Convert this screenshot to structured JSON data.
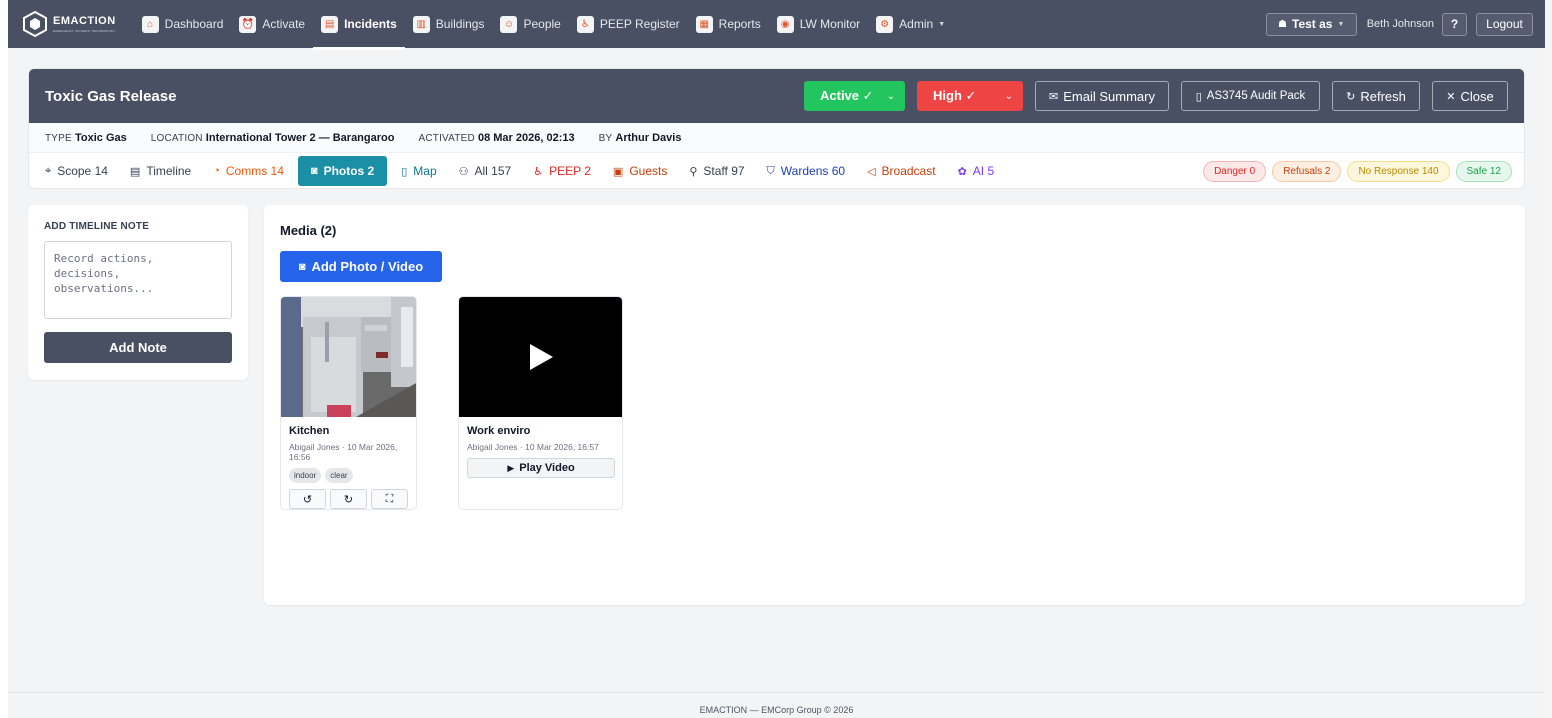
{
  "brand": {
    "name": "EMACTION",
    "tagline": "EMERGENCY INCIDENT INFORMATION"
  },
  "nav": {
    "items": [
      {
        "label": "Dashboard",
        "icon": "home-icon",
        "glyph": "⌂",
        "active": false
      },
      {
        "label": "Activate",
        "icon": "alarm-icon",
        "glyph": "⏰",
        "active": false
      },
      {
        "label": "Incidents",
        "icon": "clipboard-icon",
        "glyph": "▤",
        "active": true
      },
      {
        "label": "Buildings",
        "icon": "building-icon",
        "glyph": "▥",
        "active": false
      },
      {
        "label": "People",
        "icon": "person-icon",
        "glyph": "☺",
        "active": false
      },
      {
        "label": "PEEP Register",
        "icon": "wheelchair-icon",
        "glyph": "♿",
        "active": false
      },
      {
        "label": "Reports",
        "icon": "bar-chart-icon",
        "glyph": "▦",
        "active": false
      },
      {
        "label": "LW Monitor",
        "icon": "broadcast-icon",
        "glyph": "◉",
        "active": false
      },
      {
        "label": "Admin",
        "icon": "gear-icon",
        "glyph": "⚙",
        "active": false,
        "dropdown": true
      }
    ],
    "test_as_label": "Test as",
    "user_name": "Beth Johnson",
    "help_label": "?",
    "logout_label": "Logout"
  },
  "incident": {
    "title": "Toxic Gas Release",
    "status": "Active ✓",
    "severity": "High ✓",
    "actions": {
      "email_summary": "Email Summary",
      "audit_pack": "AS3745 Audit Pack",
      "refresh": "Refresh",
      "close": "Close"
    },
    "meta": {
      "type_key": "TYPE",
      "type_value": "Toxic Gas",
      "location_key": "LOCATION",
      "location_value": "International Tower 2 — Barangaroo",
      "activated_key": "ACTIVATED",
      "activated_value": "08 Mar 2026, 02:13",
      "by_key": "BY",
      "by_value": "Arthur Davis"
    },
    "tabs": [
      {
        "label": "Scope 14",
        "icon": "pin-icon",
        "glyph": "⌖",
        "color": "#374151"
      },
      {
        "label": "Timeline",
        "icon": "document-icon",
        "glyph": "▤",
        "color": "#374151"
      },
      {
        "label": "Comms 14",
        "icon": "chat-icon",
        "glyph": "◔",
        "color": "#ea580c"
      },
      {
        "label": "Photos 2",
        "icon": "camera-icon",
        "glyph": "◙",
        "color": "#ffffff",
        "active": true
      },
      {
        "label": "Map",
        "icon": "map-icon",
        "glyph": "▯",
        "color": "#0e7490"
      },
      {
        "label": "All 157",
        "icon": "users-icon",
        "glyph": "⚇",
        "color": "#374151"
      },
      {
        "label": "PEEP 2",
        "icon": "wheelchair-icon",
        "glyph": "♿",
        "color": "#dc2626"
      },
      {
        "label": "Guests",
        "icon": "guest-badge-icon",
        "glyph": "▣",
        "color": "#c2410c"
      },
      {
        "label": "Staff 97",
        "icon": "person-icon",
        "glyph": "⚲",
        "color": "#374151"
      },
      {
        "label": "Wardens 60",
        "icon": "shield-icon",
        "glyph": "⛉",
        "color": "#1e40af"
      },
      {
        "label": "Broadcast",
        "icon": "megaphone-icon",
        "glyph": "◁",
        "color": "#c2410c"
      },
      {
        "label": "AI 5",
        "icon": "brain-icon",
        "glyph": "✿",
        "color": "#7c3aed"
      }
    ],
    "pills": [
      {
        "label": "Danger 0",
        "color": "#dc2626",
        "bg": "#fde8e8",
        "border": "#f5b5b5"
      },
      {
        "label": "Refusals 2",
        "color": "#c2410c",
        "bg": "#feefe3",
        "border": "#f8c9a7"
      },
      {
        "label": "No Response 140",
        "color": "#b88a00",
        "bg": "#fef7dc",
        "border": "#f4dd8a"
      },
      {
        "label": "Safe 12",
        "color": "#16a34a",
        "bg": "#e6f8ec",
        "border": "#a8e2bb"
      }
    ]
  },
  "note": {
    "label": "ADD TIMELINE NOTE",
    "placeholder": "Record actions, decisions, observations...",
    "button": "Add Note"
  },
  "media": {
    "title": "Media (2)",
    "add_button": "Add Photo / Video",
    "items": [
      {
        "name": "Kitchen",
        "meta": "Abigail Jones · 10 Mar 2026, 16:56",
        "tags": [
          "indoor",
          "clear"
        ],
        "type": "photo"
      },
      {
        "name": "Work enviro",
        "meta": "Abigail Jones · 10 Mar 2026, 16:57",
        "type": "video",
        "play_label": "Play Video"
      }
    ]
  },
  "footer": {
    "text": "EMACTION — EMCorp Group © 2026"
  },
  "colors": {
    "nav_bg": "#4a5063",
    "active_status": "#22c55e",
    "high_severity": "#ef4444",
    "tab_active": "#1b8fa6",
    "primary": "#2563eb"
  }
}
